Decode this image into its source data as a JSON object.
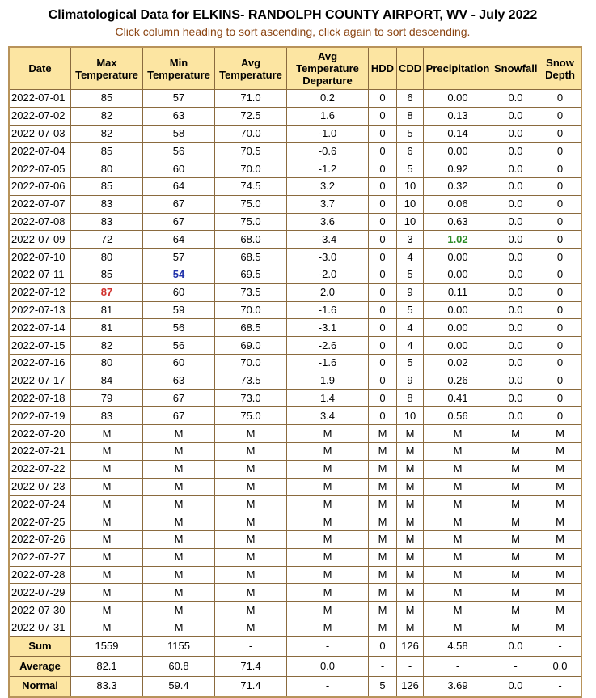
{
  "page": {
    "title": "Climatological Data for ELKINS- RANDOLPH COUNTY AIRPORT, WV - July 2022",
    "subtitle": "Click column heading to sort ascending, click again to sort descending."
  },
  "colors": {
    "header_bg": "#fce5a2",
    "border": "#b8935a",
    "subtitle": "#8B4513",
    "highest": "#d0312d",
    "lowest": "#2233aa",
    "max_precip": "#2e8b27"
  },
  "table": {
    "headers": [
      {
        "key": "date",
        "label": "Date"
      },
      {
        "key": "max_temp",
        "label": "Max Temperature"
      },
      {
        "key": "min_temp",
        "label": "Min Temperature"
      },
      {
        "key": "avg_temp",
        "label": "Avg Temperature"
      },
      {
        "key": "departure",
        "label": "Avg Temperature Departure"
      },
      {
        "key": "hdd",
        "label": "HDD"
      },
      {
        "key": "cdd",
        "label": "CDD"
      },
      {
        "key": "precip",
        "label": "Precipitation"
      },
      {
        "key": "snowfall",
        "label": "Snowfall"
      },
      {
        "key": "snow_depth",
        "label": "Snow Depth"
      }
    ],
    "rows": [
      [
        "2022-07-01",
        "85",
        "57",
        "71.0",
        "0.2",
        "0",
        "6",
        "0.00",
        "0.0",
        "0"
      ],
      [
        "2022-07-02",
        "82",
        "63",
        "72.5",
        "1.6",
        "0",
        "8",
        "0.13",
        "0.0",
        "0"
      ],
      [
        "2022-07-03",
        "82",
        "58",
        "70.0",
        "-1.0",
        "0",
        "5",
        "0.14",
        "0.0",
        "0"
      ],
      [
        "2022-07-04",
        "85",
        "56",
        "70.5",
        "-0.6",
        "0",
        "6",
        "0.00",
        "0.0",
        "0"
      ],
      [
        "2022-07-05",
        "80",
        "60",
        "70.0",
        "-1.2",
        "0",
        "5",
        "0.92",
        "0.0",
        "0"
      ],
      [
        "2022-07-06",
        "85",
        "64",
        "74.5",
        "3.2",
        "0",
        "10",
        "0.32",
        "0.0",
        "0"
      ],
      [
        "2022-07-07",
        "83",
        "67",
        "75.0",
        "3.7",
        "0",
        "10",
        "0.06",
        "0.0",
        "0"
      ],
      [
        "2022-07-08",
        "83",
        "67",
        "75.0",
        "3.6",
        "0",
        "10",
        "0.63",
        "0.0",
        "0"
      ],
      [
        "2022-07-09",
        "72",
        "64",
        "68.0",
        "-3.4",
        "0",
        "3",
        "1.02",
        "0.0",
        "0"
      ],
      [
        "2022-07-10",
        "80",
        "57",
        "68.5",
        "-3.0",
        "0",
        "4",
        "0.00",
        "0.0",
        "0"
      ],
      [
        "2022-07-11",
        "85",
        "54",
        "69.5",
        "-2.0",
        "0",
        "5",
        "0.00",
        "0.0",
        "0"
      ],
      [
        "2022-07-12",
        "87",
        "60",
        "73.5",
        "2.0",
        "0",
        "9",
        "0.11",
        "0.0",
        "0"
      ],
      [
        "2022-07-13",
        "81",
        "59",
        "70.0",
        "-1.6",
        "0",
        "5",
        "0.00",
        "0.0",
        "0"
      ],
      [
        "2022-07-14",
        "81",
        "56",
        "68.5",
        "-3.1",
        "0",
        "4",
        "0.00",
        "0.0",
        "0"
      ],
      [
        "2022-07-15",
        "82",
        "56",
        "69.0",
        "-2.6",
        "0",
        "4",
        "0.00",
        "0.0",
        "0"
      ],
      [
        "2022-07-16",
        "80",
        "60",
        "70.0",
        "-1.6",
        "0",
        "5",
        "0.02",
        "0.0",
        "0"
      ],
      [
        "2022-07-17",
        "84",
        "63",
        "73.5",
        "1.9",
        "0",
        "9",
        "0.26",
        "0.0",
        "0"
      ],
      [
        "2022-07-18",
        "79",
        "67",
        "73.0",
        "1.4",
        "0",
        "8",
        "0.41",
        "0.0",
        "0"
      ],
      [
        "2022-07-19",
        "83",
        "67",
        "75.0",
        "3.4",
        "0",
        "10",
        "0.56",
        "0.0",
        "0"
      ],
      [
        "2022-07-20",
        "M",
        "M",
        "M",
        "M",
        "M",
        "M",
        "M",
        "M",
        "M"
      ],
      [
        "2022-07-21",
        "M",
        "M",
        "M",
        "M",
        "M",
        "M",
        "M",
        "M",
        "M"
      ],
      [
        "2022-07-22",
        "M",
        "M",
        "M",
        "M",
        "M",
        "M",
        "M",
        "M",
        "M"
      ],
      [
        "2022-07-23",
        "M",
        "M",
        "M",
        "M",
        "M",
        "M",
        "M",
        "M",
        "M"
      ],
      [
        "2022-07-24",
        "M",
        "M",
        "M",
        "M",
        "M",
        "M",
        "M",
        "M",
        "M"
      ],
      [
        "2022-07-25",
        "M",
        "M",
        "M",
        "M",
        "M",
        "M",
        "M",
        "M",
        "M"
      ],
      [
        "2022-07-26",
        "M",
        "M",
        "M",
        "M",
        "M",
        "M",
        "M",
        "M",
        "M"
      ],
      [
        "2022-07-27",
        "M",
        "M",
        "M",
        "M",
        "M",
        "M",
        "M",
        "M",
        "M"
      ],
      [
        "2022-07-28",
        "M",
        "M",
        "M",
        "M",
        "M",
        "M",
        "M",
        "M",
        "M"
      ],
      [
        "2022-07-29",
        "M",
        "M",
        "M",
        "M",
        "M",
        "M",
        "M",
        "M",
        "M"
      ],
      [
        "2022-07-30",
        "M",
        "M",
        "M",
        "M",
        "M",
        "M",
        "M",
        "M",
        "M"
      ],
      [
        "2022-07-31",
        "M",
        "M",
        "M",
        "M",
        "M",
        "M",
        "M",
        "M",
        "M"
      ]
    ],
    "highlights": [
      {
        "row": 11,
        "col": 1,
        "type": "highest"
      },
      {
        "row": 10,
        "col": 2,
        "type": "lowest"
      },
      {
        "row": 8,
        "col": 7,
        "type": "max_precip"
      }
    ],
    "summary": [
      {
        "label": "Sum",
        "values": [
          "1559",
          "1155",
          "-",
          "-",
          "0",
          "126",
          "4.58",
          "0.0",
          "-"
        ]
      },
      {
        "label": "Average",
        "values": [
          "82.1",
          "60.8",
          "71.4",
          "0.0",
          "-",
          "-",
          "-",
          "-",
          "0.0"
        ]
      },
      {
        "label": "Normal",
        "values": [
          "83.3",
          "59.4",
          "71.4",
          "-",
          "5",
          "126",
          "3.69",
          "0.0",
          "-"
        ]
      }
    ]
  }
}
